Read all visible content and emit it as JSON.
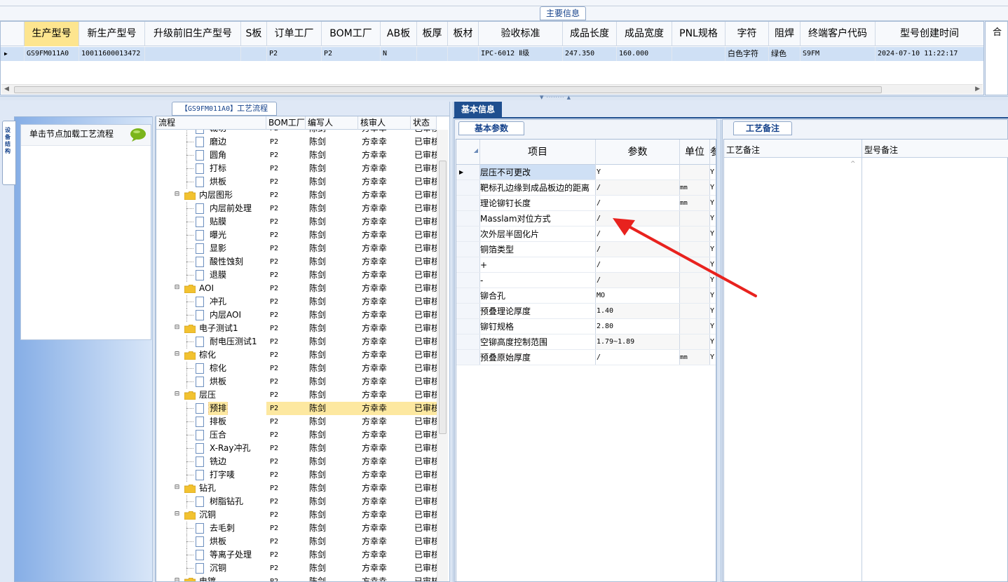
{
  "top": {
    "main_info_tab": "主要信息"
  },
  "product_grid": {
    "columns": [
      "生产型号",
      "新生产型号",
      "升级前旧生产型号",
      "S板",
      "订单工厂",
      "BOM工厂",
      "AB板",
      "板厚",
      "板材",
      "验收标准",
      "成品长度",
      "成品宽度",
      "PNL规格",
      "字符",
      "阻焊",
      "终端客户代码",
      "型号创建时间"
    ],
    "row": {
      "production_model": "GS9FM011A0",
      "new_model": "10011600013472",
      "old_model": "",
      "s_board": "",
      "order_factory": "P2",
      "bom_factory": "P2",
      "ab_board": "N",
      "thickness": "",
      "material": "",
      "acceptance": "IPC-6012 Ⅱ级",
      "length": "247.350",
      "width": "160.000",
      "pnl": "",
      "char": "白色字符",
      "solder_mask": "绿色",
      "customer_code": "S9FM",
      "created": "2024-07-10 11:22:17"
    },
    "right_stub_label": "合"
  },
  "left": {
    "side_tab": "设备结构",
    "load_hint": "单击节点加载工艺流程"
  },
  "flow_tab": {
    "model": "【GS9FM011A0】",
    "label": "工艺流程"
  },
  "tree": {
    "columns": [
      "流程",
      "BOM工厂",
      "编写人",
      "核审人",
      "状态"
    ],
    "rows": [
      {
        "label": "裁切",
        "level": 1,
        "factory": "P2",
        "writer": "陈剑",
        "reviewer": "方幸幸",
        "status": "已审核"
      },
      {
        "label": "磨边",
        "level": 1,
        "factory": "P2",
        "writer": "陈剑",
        "reviewer": "方幸幸",
        "status": "已审核"
      },
      {
        "label": "圆角",
        "level": 1,
        "factory": "P2",
        "writer": "陈剑",
        "reviewer": "方幸幸",
        "status": "已审核"
      },
      {
        "label": "打标",
        "level": 1,
        "factory": "P2",
        "writer": "陈剑",
        "reviewer": "方幸幸",
        "status": "已审核"
      },
      {
        "label": "烘板",
        "level": 1,
        "factory": "P2",
        "writer": "陈剑",
        "reviewer": "方幸幸",
        "status": "已审核"
      },
      {
        "label": "内层图形",
        "level": 0,
        "factory": "P2",
        "writer": "陈剑",
        "reviewer": "方幸幸",
        "status": "已审核"
      },
      {
        "label": "内层前处理",
        "level": 1,
        "factory": "P2",
        "writer": "陈剑",
        "reviewer": "方幸幸",
        "status": "已审核"
      },
      {
        "label": "贴膜",
        "level": 1,
        "factory": "P2",
        "writer": "陈剑",
        "reviewer": "方幸幸",
        "status": "已审核"
      },
      {
        "label": "曝光",
        "level": 1,
        "factory": "P2",
        "writer": "陈剑",
        "reviewer": "方幸幸",
        "status": "已审核"
      },
      {
        "label": "显影",
        "level": 1,
        "factory": "P2",
        "writer": "陈剑",
        "reviewer": "方幸幸",
        "status": "已审核"
      },
      {
        "label": "酸性蚀刻",
        "level": 1,
        "factory": "P2",
        "writer": "陈剑",
        "reviewer": "方幸幸",
        "status": "已审核"
      },
      {
        "label": "退膜",
        "level": 1,
        "factory": "P2",
        "writer": "陈剑",
        "reviewer": "方幸幸",
        "status": "已审核"
      },
      {
        "label": "AOI",
        "level": 0,
        "factory": "P2",
        "writer": "陈剑",
        "reviewer": "方幸幸",
        "status": "已审核"
      },
      {
        "label": "冲孔",
        "level": 1,
        "factory": "P2",
        "writer": "陈剑",
        "reviewer": "方幸幸",
        "status": "已审核"
      },
      {
        "label": "内层AOI",
        "level": 1,
        "factory": "P2",
        "writer": "陈剑",
        "reviewer": "方幸幸",
        "status": "已审核"
      },
      {
        "label": "电子测试1",
        "level": 0,
        "factory": "P2",
        "writer": "陈剑",
        "reviewer": "方幸幸",
        "status": "已审核"
      },
      {
        "label": "耐电压测试1",
        "level": 1,
        "factory": "P2",
        "writer": "陈剑",
        "reviewer": "方幸幸",
        "status": "已审核"
      },
      {
        "label": "棕化",
        "level": 0,
        "factory": "P2",
        "writer": "陈剑",
        "reviewer": "方幸幸",
        "status": "已审核"
      },
      {
        "label": "棕化",
        "level": 1,
        "factory": "P2",
        "writer": "陈剑",
        "reviewer": "方幸幸",
        "status": "已审核"
      },
      {
        "label": "烘板",
        "level": 1,
        "factory": "P2",
        "writer": "陈剑",
        "reviewer": "方幸幸",
        "status": "已审核"
      },
      {
        "label": "层压",
        "level": 0,
        "factory": "P2",
        "writer": "陈剑",
        "reviewer": "方幸幸",
        "status": "已审核"
      },
      {
        "label": "预排",
        "level": 1,
        "factory": "P2",
        "writer": "陈剑",
        "reviewer": "方幸幸",
        "status": "已审核",
        "selected": true
      },
      {
        "label": "排板",
        "level": 1,
        "factory": "P2",
        "writer": "陈剑",
        "reviewer": "方幸幸",
        "status": "已审核"
      },
      {
        "label": "压合",
        "level": 1,
        "factory": "P2",
        "writer": "陈剑",
        "reviewer": "方幸幸",
        "status": "已审核"
      },
      {
        "label": "X-Ray冲孔",
        "level": 1,
        "factory": "P2",
        "writer": "陈剑",
        "reviewer": "方幸幸",
        "status": "已审核"
      },
      {
        "label": "铣边",
        "level": 1,
        "factory": "P2",
        "writer": "陈剑",
        "reviewer": "方幸幸",
        "status": "已审核"
      },
      {
        "label": "打字唛",
        "level": 1,
        "factory": "P2",
        "writer": "陈剑",
        "reviewer": "方幸幸",
        "status": "已审核"
      },
      {
        "label": "钻孔",
        "level": 0,
        "factory": "P2",
        "writer": "陈剑",
        "reviewer": "方幸幸",
        "status": "已审核"
      },
      {
        "label": "树脂钻孔",
        "level": 1,
        "factory": "P2",
        "writer": "陈剑",
        "reviewer": "方幸幸",
        "status": "已审核"
      },
      {
        "label": "沉铜",
        "level": 0,
        "factory": "P2",
        "writer": "陈剑",
        "reviewer": "方幸幸",
        "status": "已审核"
      },
      {
        "label": "去毛刺",
        "level": 1,
        "factory": "P2",
        "writer": "陈剑",
        "reviewer": "方幸幸",
        "status": "已审核"
      },
      {
        "label": "烘板",
        "level": 1,
        "factory": "P2",
        "writer": "陈剑",
        "reviewer": "方幸幸",
        "status": "已审核"
      },
      {
        "label": "等离子处理",
        "level": 1,
        "factory": "P2",
        "writer": "陈剑",
        "reviewer": "方幸幸",
        "status": "已审核"
      },
      {
        "label": "沉铜",
        "level": 1,
        "factory": "P2",
        "writer": "陈剑",
        "reviewer": "方幸幸",
        "status": "已审核"
      },
      {
        "label": "电镀",
        "level": 0,
        "factory": "P2",
        "writer": "陈剑",
        "reviewer": "方幸幸",
        "status": "已审核"
      }
    ]
  },
  "basic_info": {
    "tab": "基本信息",
    "param_tab": "基本参数",
    "columns": [
      "项目",
      "参数",
      "单位",
      "参"
    ],
    "rows": [
      {
        "item": "层压不可更改",
        "value": "Y",
        "unit": "",
        "extra": "Y"
      },
      {
        "item": "靶标孔边缘到成品板边的距离",
        "value": "/",
        "unit": "mm",
        "extra": "Y"
      },
      {
        "item": "理论铆钉长度",
        "value": "/",
        "unit": "mm",
        "extra": "Y"
      },
      {
        "item": "Masslam对位方式",
        "value": "/",
        "unit": "",
        "extra": "Y"
      },
      {
        "item": "次外层半固化片",
        "value": "/",
        "unit": "",
        "extra": "Y"
      },
      {
        "item": "铜箔类型",
        "value": "/",
        "unit": "",
        "extra": "Y"
      },
      {
        "item": "+",
        "value": "/",
        "unit": "",
        "extra": "Y"
      },
      {
        "item": "-",
        "value": "/",
        "unit": "",
        "extra": "Y"
      },
      {
        "item": "铆合孔",
        "value": "MO",
        "unit": "",
        "extra": "Y"
      },
      {
        "item": "预叠理论厚度",
        "value": "1.40",
        "unit": "",
        "extra": "Y"
      },
      {
        "item": "铆钉规格",
        "value": "2.80",
        "unit": "",
        "extra": "Y"
      },
      {
        "item": "空铆高度控制范围",
        "value": "1.79~1.89",
        "unit": "",
        "extra": "Y"
      },
      {
        "item": "预叠原始厚度",
        "value": "/",
        "unit": "mm",
        "extra": "Y"
      }
    ]
  },
  "remark": {
    "tab": "工艺备注",
    "col1": "工艺备注",
    "col2": "型号备注"
  },
  "colors": {
    "accent": "#1f4f8f",
    "selection": "#fde58f",
    "arrow": "#e8221e"
  }
}
